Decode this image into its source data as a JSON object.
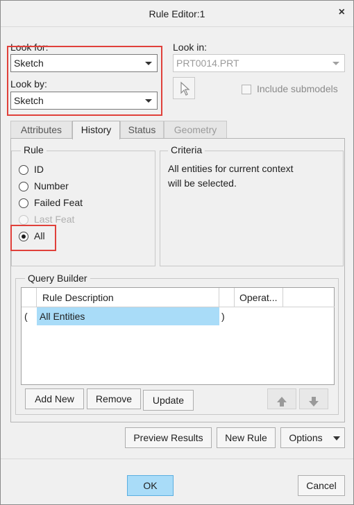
{
  "window": {
    "title": "Rule Editor:1",
    "close_glyph": "×"
  },
  "look_for": {
    "label": "Look for:",
    "value": "Sketch"
  },
  "look_by": {
    "label": "Look by:",
    "value": "Sketch"
  },
  "look_in": {
    "label": "Look in:",
    "value": "PRT0014.PRT",
    "include_submodels_label": "Include submodels",
    "include_submodels_checked": false
  },
  "tabs": [
    {
      "label": "Attributes",
      "state": "normal"
    },
    {
      "label": "History",
      "state": "active"
    },
    {
      "label": "Status",
      "state": "normal"
    },
    {
      "label": "Geometry",
      "state": "disabled"
    }
  ],
  "rule": {
    "title": "Rule",
    "options": [
      {
        "label": "ID",
        "state": "unchecked"
      },
      {
        "label": "Number",
        "state": "unchecked"
      },
      {
        "label": "Failed Feat",
        "state": "unchecked"
      },
      {
        "label": "Last Feat",
        "state": "disabled"
      },
      {
        "label": "All",
        "state": "checked"
      }
    ]
  },
  "criteria": {
    "title": "Criteria",
    "line1": "All entities for current context",
    "line2": "will be selected."
  },
  "query_builder": {
    "title": "Query Builder",
    "columns": [
      "Rule Description",
      "Operat..."
    ],
    "rows": [
      {
        "open_paren": "(",
        "description": "All Entities",
        "close_paren": ")"
      }
    ],
    "buttons": {
      "add_new": "Add New",
      "remove": "Remove",
      "update": "Update"
    }
  },
  "actions": {
    "preview_results": "Preview Results",
    "new_rule": "New Rule",
    "options": "Options"
  },
  "footer": {
    "ok": "OK",
    "cancel": "Cancel"
  },
  "colors": {
    "highlight": "#a9dcf8",
    "annotation_red": "#e0403a"
  },
  "icons": [
    "close-icon",
    "dropdown-arrow-icon",
    "pointer-select-icon",
    "move-up-icon",
    "move-down-icon",
    "options-dropdown-icon"
  ]
}
